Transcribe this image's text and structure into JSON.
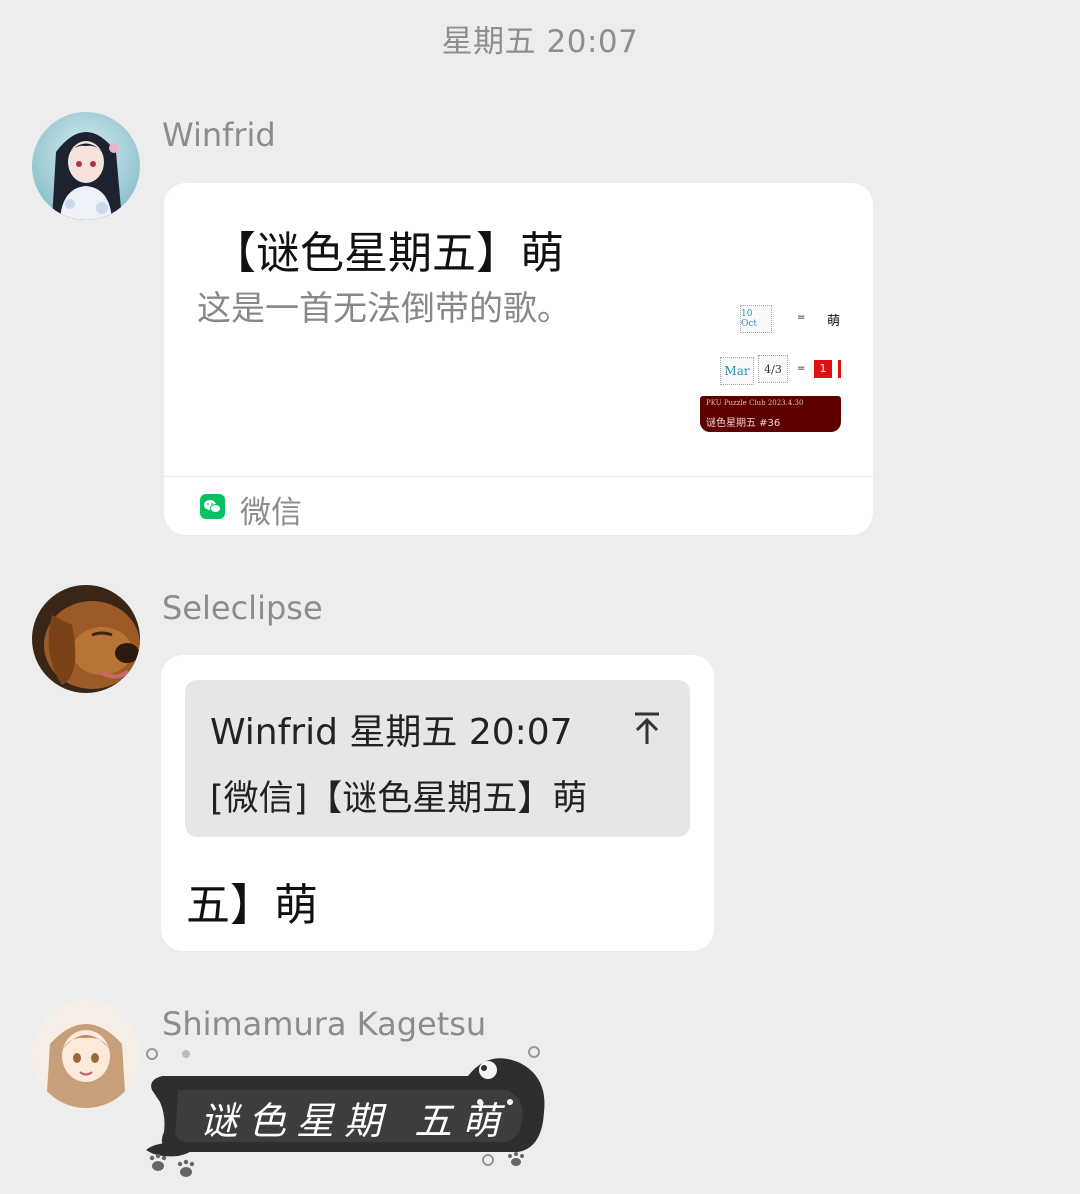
{
  "timestamp": "星期五 20:07",
  "messages": [
    {
      "sender": "Winfrid",
      "card": {
        "title": "【谜色星期五】萌",
        "description": "这是一首无法倒带的歌。",
        "source": "微信",
        "thumbnail": {
          "row1_box": "10 Oct",
          "row1_eq": "=",
          "row1_result": "萌",
          "row2_box1": "Mar",
          "row2_box2": "4/3",
          "row2_eq": "=",
          "row2_result": "1",
          "banner_line1": "PKU Puzzle Club 2023.4.30",
          "banner_line2": "谜色星期五 #36"
        }
      }
    },
    {
      "sender": "Seleclipse",
      "quote": {
        "meta": "Winfrid 星期五 20:07",
        "text": "[微信]【谜色星期五】萌"
      },
      "text": "五】萌"
    },
    {
      "sender": "Shimamura Kagetsu",
      "sticker_text": "谜色星期 五萌"
    }
  ],
  "colors": {
    "background": "#ededed",
    "bubble": "#ffffff",
    "quote_bg": "#e6e6e6",
    "wechat_green": "#07c160",
    "banner_red": "#5c0000"
  }
}
